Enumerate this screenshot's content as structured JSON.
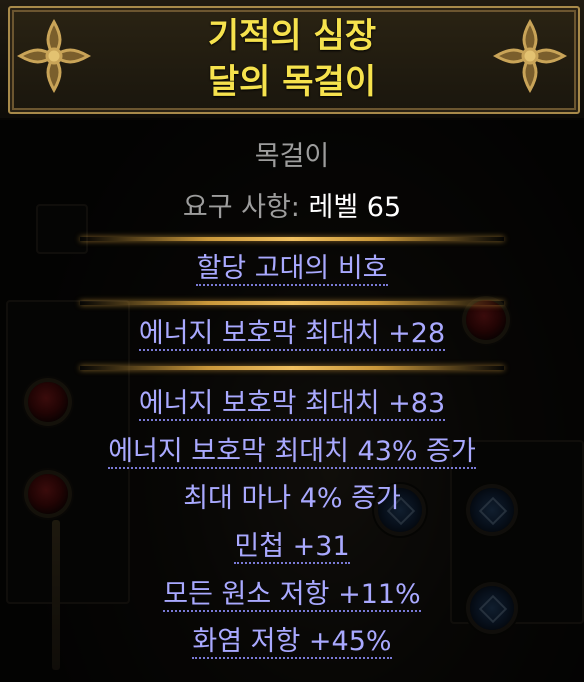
{
  "item": {
    "name_line1": "기적의 심장",
    "name_line2": "달의 목걸이",
    "type": "목걸이",
    "requirement_label": "요구 사항:",
    "requirement_value": "레벨 65",
    "enchant": "할당 고대의 비호",
    "implicit": "에너지 보호막 최대치 +28",
    "explicits": [
      "에너지 보호막 최대치 +83",
      "에너지 보호막 최대치 43% 증가",
      "최대 마나 4% 증가",
      "민첩 +31",
      "모든 원소 저항 +11%",
      "화염 저항 +45%"
    ]
  },
  "colors": {
    "title": "#f6e24d",
    "type_text": "#9d9d9d",
    "mod_text": "#a9a9ff",
    "separator": "#c9973a"
  },
  "icons": [
    "fleur-ornament-icon",
    "red-gem-socket-icon",
    "blue-rune-socket-icon"
  ]
}
